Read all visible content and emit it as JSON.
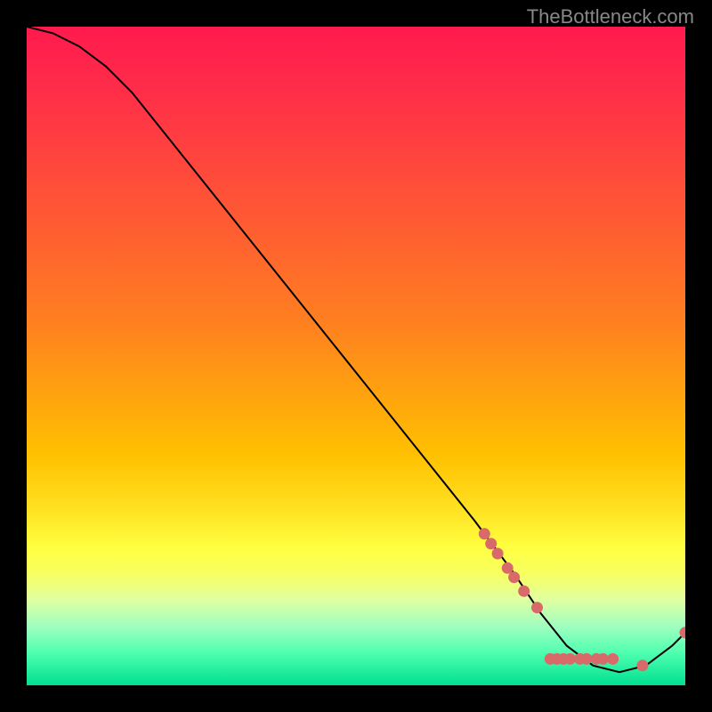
{
  "watermark": "TheBottleneck.com",
  "chart_data": {
    "type": "line",
    "title": "",
    "xlabel": "",
    "ylabel": "",
    "xlim": [
      0,
      100
    ],
    "ylim": [
      0,
      100
    ],
    "series": [
      {
        "name": "curve",
        "x": [
          0,
          4,
          8,
          12,
          16,
          20,
          28,
          36,
          44,
          52,
          60,
          68,
          74,
          78,
          82,
          86,
          90,
          94,
          98,
          100
        ],
        "y": [
          100,
          99,
          97,
          94,
          90,
          85,
          75,
          65,
          55,
          45,
          35,
          25,
          17,
          11,
          6,
          3,
          2,
          3,
          6,
          8
        ]
      }
    ],
    "markers": [
      {
        "x": 69.5,
        "y": 23.0
      },
      {
        "x": 70.5,
        "y": 21.5
      },
      {
        "x": 71.5,
        "y": 20.0
      },
      {
        "x": 73.0,
        "y": 17.8
      },
      {
        "x": 74.0,
        "y": 16.4
      },
      {
        "x": 75.5,
        "y": 14.3
      },
      {
        "x": 77.5,
        "y": 11.8
      },
      {
        "x": 79.5,
        "y": 4.0
      },
      {
        "x": 80.5,
        "y": 4.0
      },
      {
        "x": 81.5,
        "y": 4.0
      },
      {
        "x": 82.5,
        "y": 4.0
      },
      {
        "x": 84.0,
        "y": 4.0
      },
      {
        "x": 85.0,
        "y": 4.0
      },
      {
        "x": 86.5,
        "y": 4.0
      },
      {
        "x": 87.5,
        "y": 4.0
      },
      {
        "x": 89.0,
        "y": 4.0
      },
      {
        "x": 93.5,
        "y": 3.0
      },
      {
        "x": 100.0,
        "y": 8.0
      }
    ],
    "marker_color": "#d96a6a",
    "curve_color": "#000000"
  }
}
